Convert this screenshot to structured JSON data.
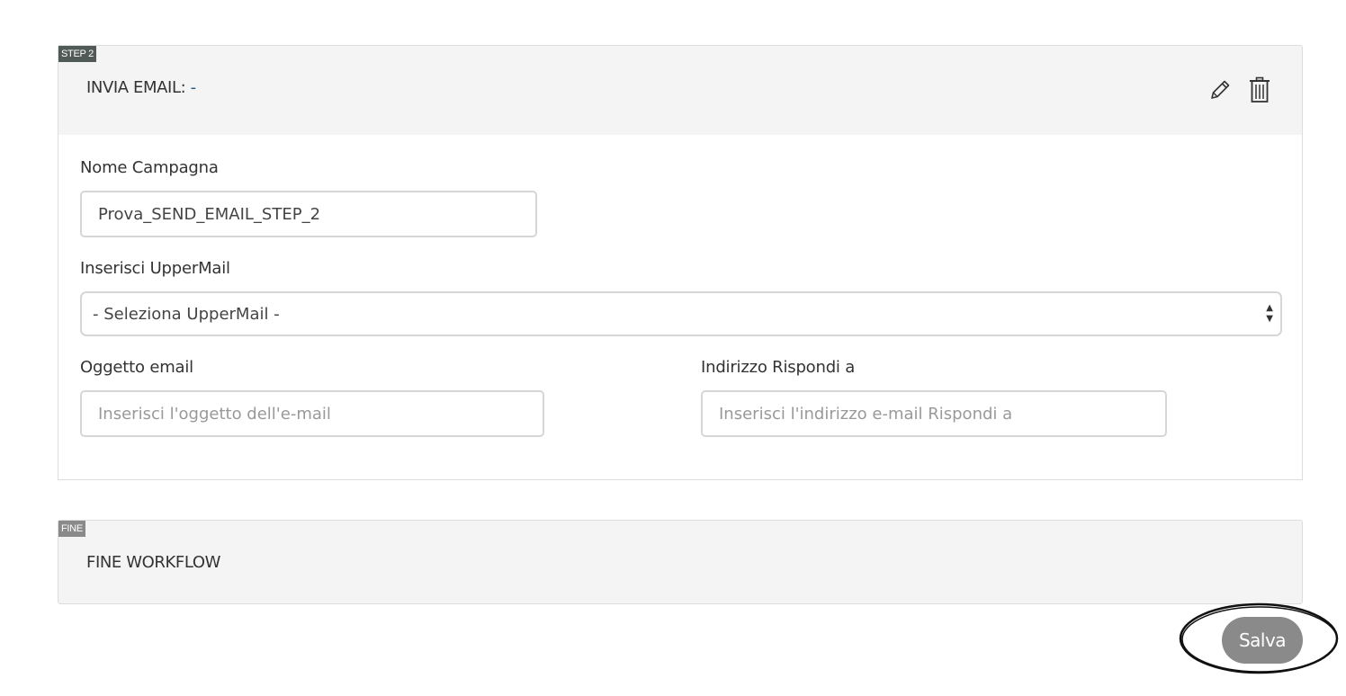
{
  "step2": {
    "badge": "STEP 2",
    "title": "INVIA EMAIL:",
    "title_value": "-",
    "edit_icon": "pencil-icon",
    "delete_icon": "trash-icon"
  },
  "form": {
    "campaign_name": {
      "label": "Nome Campagna",
      "value": "Prova_SEND_EMAIL_STEP_2"
    },
    "uppermail": {
      "label": "Inserisci UpperMail",
      "selected": "- Seleziona UpperMail -"
    },
    "subject": {
      "label": "Oggetto email",
      "placeholder": "Inserisci l'oggetto dell'e-mail"
    },
    "reply_to": {
      "label": "Indirizzo Rispondi a",
      "placeholder": "Inserisci l'indirizzo e-mail Rispondi a"
    }
  },
  "fine": {
    "badge": "FINE",
    "title": "FINE WORKFLOW"
  },
  "actions": {
    "save_label": "Salva"
  },
  "colors": {
    "header_bg": "#f4f4f4",
    "badge_dark": "#505a56",
    "badge_gray": "#8a8a8a",
    "save_button": "#8a8a8a",
    "title_dash": "#1e5a8a"
  }
}
